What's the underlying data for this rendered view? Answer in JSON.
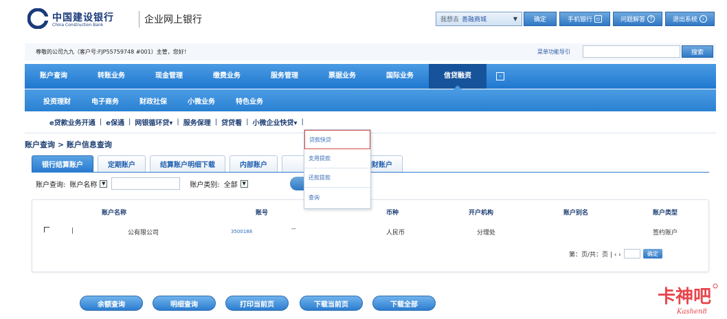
{
  "header": {
    "logo_cn": "中国建设银行",
    "logo_en": "China Construction Bank",
    "subtitle": "企业网上银行",
    "select_prefix": "我想去",
    "select_value": "善融商城",
    "buttons": [
      "确定",
      "手机银行",
      "问题解答",
      "退出系统"
    ]
  },
  "greeting": {
    "text": "尊敬的公司九九（客户号:FJP55759748 #001）主管，您好！",
    "search_label": "菜单功能导引",
    "search_placeholder": "",
    "search_button": "搜索"
  },
  "nav_main": [
    "账户查询",
    "转账业务",
    "现金管理",
    "缴费业务",
    "服务管理",
    "票据业务",
    "国际业务",
    "信贷融资"
  ],
  "nav_main_active": "信贷融资",
  "nav_main_icon": "-",
  "nav_sub": [
    "投资理财",
    "电子商务",
    "财政社保",
    "小微业务",
    "特色业务"
  ],
  "nav_third": {
    "items": [
      "e贷款业务开通",
      "e保通",
      "网银循环贷▾",
      "服务保理",
      "贷贷看",
      "小微企业快贷▾"
    ],
    "sep": "|"
  },
  "breadcrumb": "账户查询 > 账户信息查询",
  "tabs": [
    "银行结算账户",
    "定期账户",
    "结算账户明细下载",
    "内部账户",
    "",
    "理财账户"
  ],
  "tabs_active_index": 0,
  "filter": {
    "label": "账户查询:",
    "field_select": "账户名称",
    "type_label": "账户类别:",
    "type_value": "全部"
  },
  "dropdown": {
    "items": [
      "贷款快贷",
      "支用提款",
      "还款提款",
      "查询"
    ],
    "highlighted_index": 0
  },
  "table": {
    "headers": [
      "账户名称",
      "账号",
      "币种",
      "开户机构",
      "账户别名",
      "账户类型"
    ],
    "row": {
      "mark": "|",
      "name": "公有限公司",
      "account": "3500188",
      "account2": "--",
      "currency": "人民币",
      "branch": "分理处",
      "type": "签约账户"
    }
  },
  "pager": {
    "text": "第：页/共：页 | ‹ ›",
    "go": "确定"
  },
  "bottom_buttons": [
    "余额查询",
    "明细查询",
    "打印当前页",
    "下载当前页",
    "下载全部"
  ],
  "watermark": {
    "cn": "卡神吧",
    "en": "Kashen8",
    "color": "#e8454c"
  }
}
